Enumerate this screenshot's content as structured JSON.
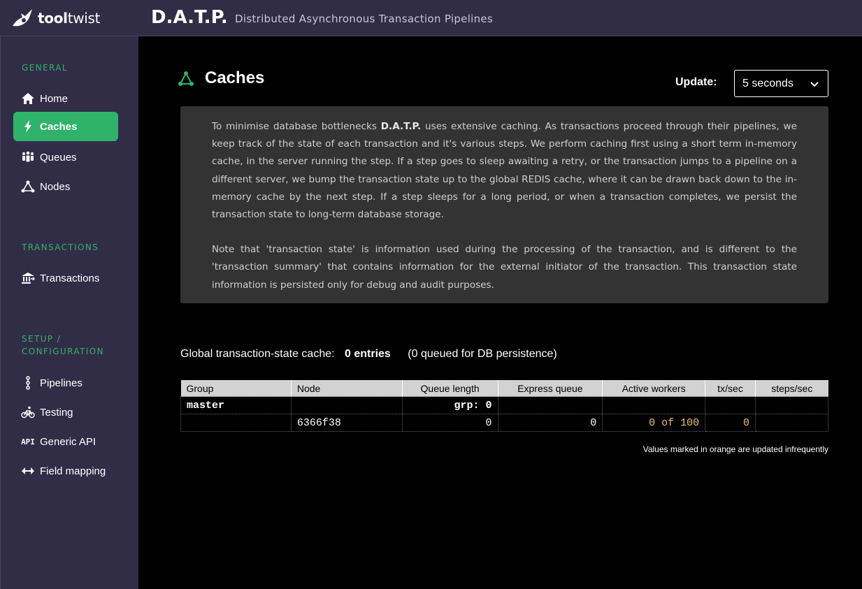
{
  "brand": {
    "logo_bold": "tool",
    "logo_light": "twist"
  },
  "header": {
    "title": "D.A.T.P.",
    "subtitle": "Distributed Asynchronous Transaction Pipelines"
  },
  "sidebar": {
    "sections": [
      {
        "label": "GENERAL"
      },
      {
        "label": "TRANSACTIONS"
      },
      {
        "label_line1": "SETUP /",
        "label_line2": "CONFIGURATION"
      }
    ],
    "items": [
      {
        "label": "Home",
        "icon": "home-icon"
      },
      {
        "label": "Caches",
        "icon": "lightning-icon",
        "active": true
      },
      {
        "label": "Queues",
        "icon": "people-icon"
      },
      {
        "label": "Nodes",
        "icon": "network-icon"
      },
      {
        "label": "Transactions",
        "icon": "bank-icon"
      },
      {
        "label": "Pipelines",
        "icon": "pipeline-icon"
      },
      {
        "label": "Testing",
        "icon": "bicycle-icon"
      },
      {
        "label": "Generic API",
        "icon": "api-icon"
      },
      {
        "label": "Field mapping",
        "icon": "arrows-icon"
      }
    ],
    "api_glyph": "API"
  },
  "page": {
    "title": "Caches",
    "update_label": "Update:",
    "update_value": "5 seconds",
    "info": {
      "p1_before": "To minimise database bottlenecks ",
      "p1_bold": "D.A.T.P.",
      "p1_after": " uses extensive caching. As transactions proceed through their pipelines, we keep track of the state of each transaction and it's various steps. We perform caching first using a short term in-memory cache, in the server running the step. If a step goes to sleep awaiting a retry, or the transaction jumps to a pipeline on a different server, we bump the transaction state up to the global REDIS cache, where it can be drawn back down to the in-memory cache by the next step. If a step sleeps for a long period, or when a transaction completes, we persist the transaction state to long-term database storage.",
      "p2": "Note that 'transaction state' is information used during the processing of the transaction, and is different to the 'transaction summary' that contains information for the external initiator of the transaction. This transaction state information is persisted only for debug and audit purposes."
    },
    "cache_label": "Global transaction-state cache:",
    "cache_entries": "0 entries",
    "cache_queued": "(0 queued for DB persistence)",
    "table": {
      "headers": [
        "Group",
        "Node",
        "Queue length",
        "Express queue",
        "Active workers",
        "tx/sec",
        "steps/sec"
      ],
      "group_row": {
        "group": "master",
        "queue_length": "grp: 0"
      },
      "node_row": {
        "node": "6366f38",
        "queue_length": "0",
        "express_queue": "0",
        "active_workers": "0 of 100",
        "tx_sec": "0"
      }
    },
    "footnote": "Values marked in orange are updated infrequently"
  },
  "colors": {
    "accent": "#2fb36a",
    "sidebar": "#322d47",
    "orange": "#f3c36b"
  }
}
